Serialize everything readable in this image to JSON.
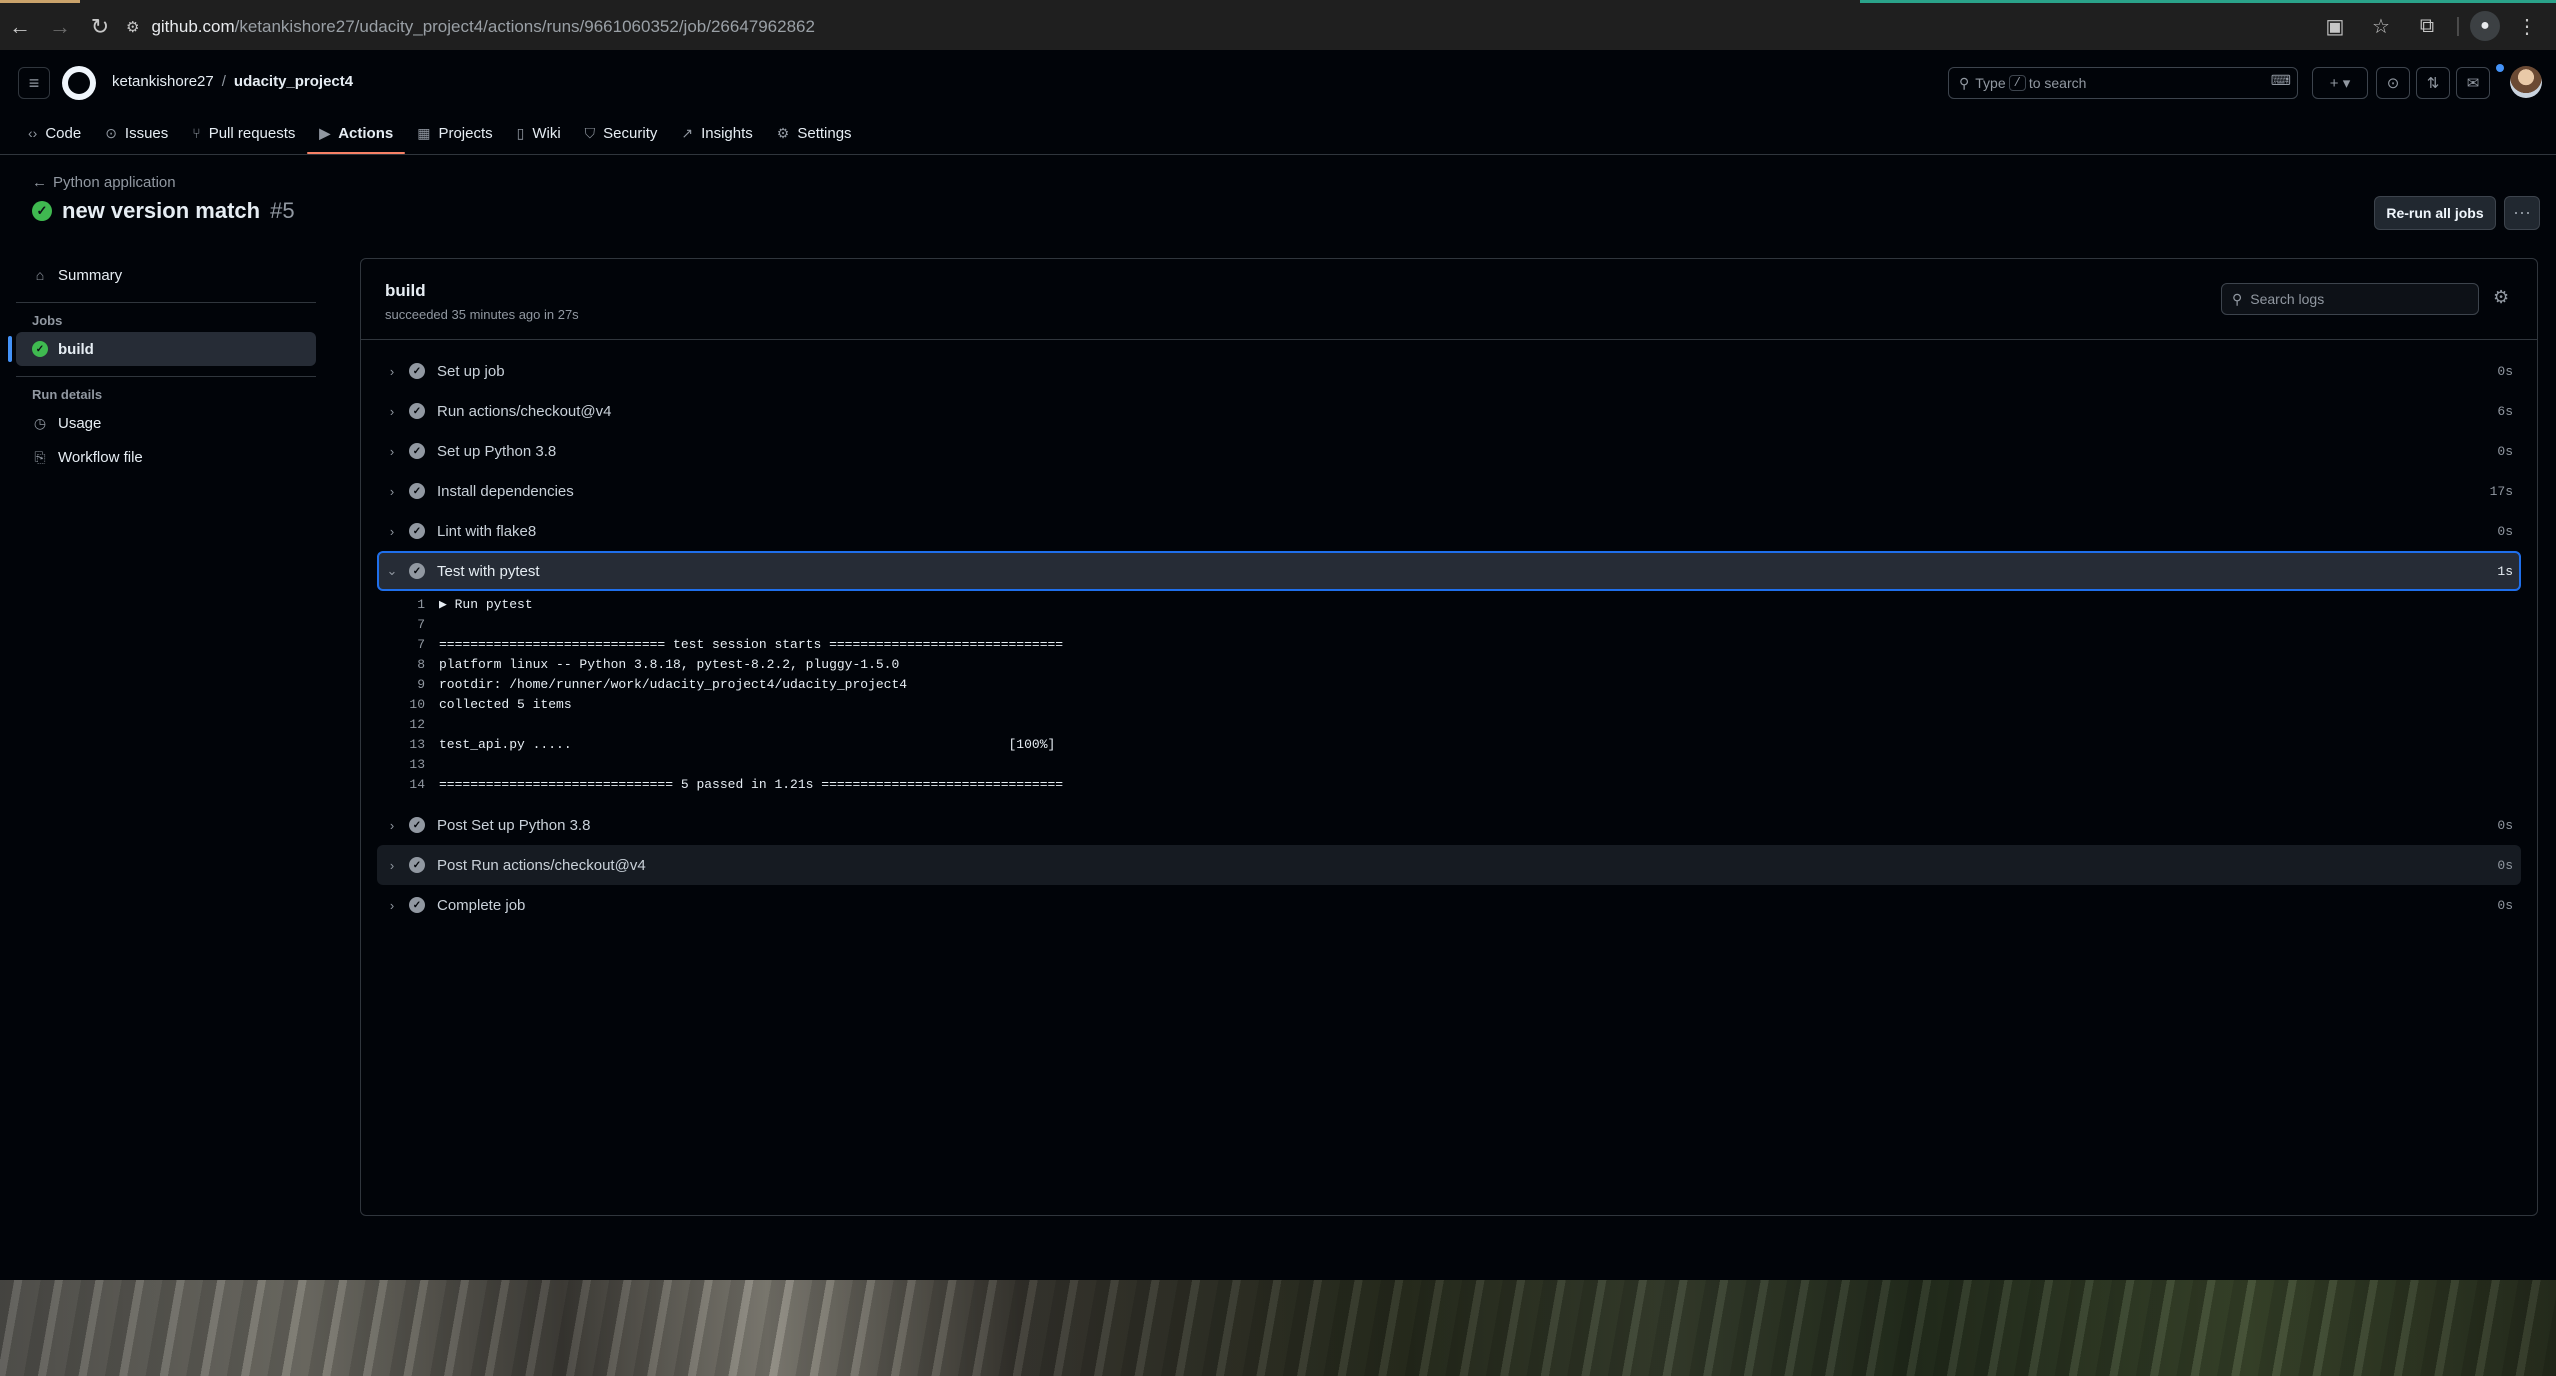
{
  "browser": {
    "url_host": "github.com",
    "url_path": "/ketankishore27/udacity_project4/actions/runs/9661060352/job/26647962862"
  },
  "header": {
    "owner": "ketankishore27",
    "separator": "/",
    "repo": "udacity_project4",
    "search_before": "Type",
    "search_key": "/",
    "search_after": "to search"
  },
  "nav": {
    "tabs": [
      {
        "label": "Code",
        "icon": "code-icon"
      },
      {
        "label": "Issues",
        "icon": "issue-icon"
      },
      {
        "label": "Pull requests",
        "icon": "pull-request-icon"
      },
      {
        "label": "Actions",
        "icon": "actions-icon",
        "active": true
      },
      {
        "label": "Projects",
        "icon": "projects-icon"
      },
      {
        "label": "Wiki",
        "icon": "book-icon"
      },
      {
        "label": "Security",
        "icon": "shield-icon"
      },
      {
        "label": "Insights",
        "icon": "graph-icon"
      },
      {
        "label": "Settings",
        "icon": "gear-icon"
      }
    ]
  },
  "run": {
    "workflow": "Python application",
    "title": "new version match",
    "number": "#5",
    "rerun_label": "Re-run all jobs"
  },
  "sidebar": {
    "summary": "Summary",
    "jobs_heading": "Jobs",
    "job": "build",
    "details_heading": "Run details",
    "usage": "Usage",
    "workflow_file": "Workflow file"
  },
  "job": {
    "name": "build",
    "status": "succeeded 35 minutes ago in 27s",
    "search_placeholder": "Search logs"
  },
  "steps_before": [
    {
      "name": "Set up job",
      "duration": "0s"
    },
    {
      "name": "Run actions/checkout@v4",
      "duration": "6s"
    },
    {
      "name": "Set up Python 3.8",
      "duration": "0s"
    },
    {
      "name": "Install dependencies",
      "duration": "17s"
    },
    {
      "name": "Lint with flake8",
      "duration": "0s"
    }
  ],
  "expanded_step": {
    "name": "Test with pytest",
    "duration": "1s"
  },
  "log_lines": [
    {
      "n": "1",
      "text": "▶ Run pytest"
    },
    {
      "n": "7",
      "text": ""
    },
    {
      "n": "7",
      "text": "============================= test session starts =============================="
    },
    {
      "n": "8",
      "text": "platform linux -- Python 3.8.18, pytest-8.2.2, pluggy-1.5.0"
    },
    {
      "n": "9",
      "text": "rootdir: /home/runner/work/udacity_project4/udacity_project4"
    },
    {
      "n": "10",
      "text": "collected 5 items"
    },
    {
      "n": "12",
      "text": ""
    },
    {
      "n": "13",
      "text": "test_api.py .....                                                        [100%]"
    },
    {
      "n": "13",
      "text": ""
    },
    {
      "n": "14",
      "text": "============================== 5 passed in 1.21s ==============================="
    }
  ],
  "steps_after": [
    {
      "name": "Post Set up Python 3.8",
      "duration": "0s"
    },
    {
      "name": "Post Run actions/checkout@v4",
      "duration": "0s"
    },
    {
      "name": "Complete job",
      "duration": "0s"
    }
  ],
  "colors": {
    "success": "#3fb950",
    "accent": "#1f6feb",
    "tab_underline": "#f78166"
  }
}
